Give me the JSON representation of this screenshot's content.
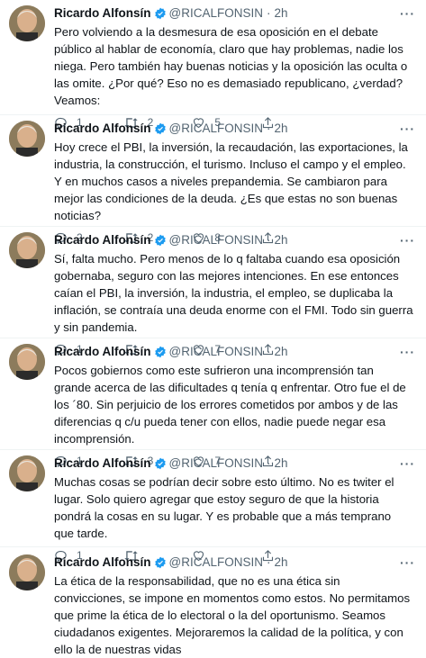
{
  "tweets": [
    {
      "name": "Ricardo Alfonsín",
      "handle": "@RICALFONSIN",
      "dot": "·",
      "time": "2h",
      "text": "Pero volviendo a la desmesura de esa oposición en el debate público al hablar de economía, claro que hay problemas, nadie los niega. Pero también hay buenas noticias y la oposición las oculta o las omite. ¿Por qué? Eso no es demasiado republicano, ¿verdad? Veamos:",
      "replies": "1",
      "retweets": "2",
      "likes": "5"
    },
    {
      "name": "Ricardo Alfonsín",
      "handle": "@RICALFONSIN",
      "dot": "·",
      "time": "2h",
      "text": "Hoy crece el PBI, la inversión, la recaudación, las exportaciones, la industria, la construcción, el turismo. Incluso el campo y el empleo. Y en muchos casos a niveles prepandemia. Se cambiaron para mejor las condiciones de la deuda. ¿Es que estas no son buenas noticias?",
      "replies": "2",
      "retweets": "2",
      "likes": "8"
    },
    {
      "name": "Ricardo Alfonsín",
      "handle": "@RICALFONSIN",
      "dot": "·",
      "time": "2h",
      "text": "Sí, falta mucho. Pero menos de lo q faltaba cuando esa oposición gobernaba, seguro con las mejores intenciones. En ese entonces caían el PBI, la inversión, la industria, el empleo, se duplicaba la inflación, se contraía una deuda enorme con el FMI. Todo sin guerra y sin pandemia.",
      "replies": "1",
      "retweets": "",
      "likes": "7"
    },
    {
      "name": "Ricardo Alfonsín",
      "handle": "@RICALFONSIN",
      "dot": "·",
      "time": "2h",
      "text": "Pocos gobiernos como este sufrieron una incomprensión tan grande acerca de las dificultades q tenía q enfrentar. Otro fue el de los ´80. Sin perjuicio de los errores cometidos por ambos y de las diferencias q c/u pueda tener con ellos, nadie puede negar esa incomprensión.",
      "replies": "1",
      "retweets": "3",
      "likes": "7"
    },
    {
      "name": "Ricardo Alfonsín",
      "handle": "@RICALFONSIN",
      "dot": "·",
      "time": "2h",
      "text": "Muchas cosas se podrían decir sobre esto último. No es twiter el lugar. Solo quiero agregar que estoy seguro de que la historia pondrá la cosas en su lugar. Y es probable que a más temprano que tarde.",
      "replies": "1",
      "retweets": "",
      "likes": ""
    },
    {
      "name": "Ricardo Alfonsín",
      "handle": "@RICALFONSIN",
      "dot": "·",
      "time": "2h",
      "text": "La ética de la responsabilidad, que no es una ética sin convicciones, se impone  en momentos como estos. No permitamos que prime la ética de lo electoral o la del oportunismo. Seamos ciudadanos exigentes. Mejoraremos la calidad de la política, y con ello la de nuestras vidas",
      "replies": "",
      "retweets": "",
      "likes": ""
    }
  ]
}
